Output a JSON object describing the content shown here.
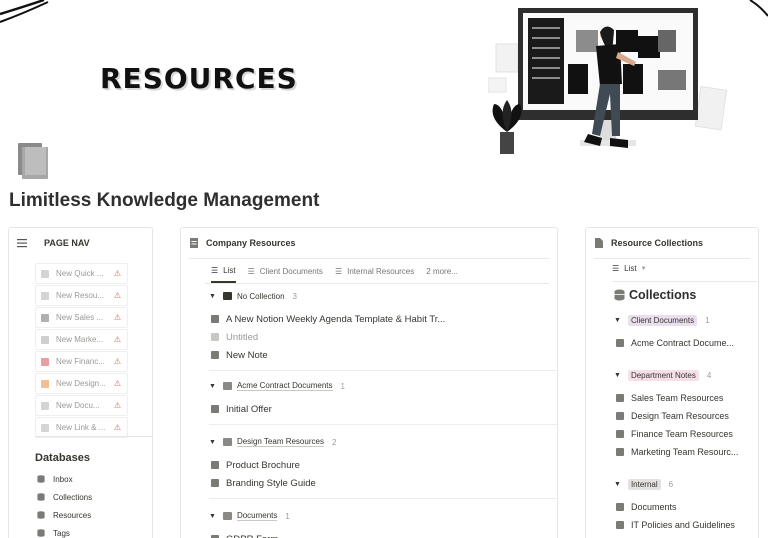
{
  "banner": {
    "title": "RESOURCES"
  },
  "page": {
    "title": "Limitless Knowledge Management"
  },
  "colors": {
    "warning": "#e06a5e",
    "client_tag_bg": "#e8deee",
    "dept_tag_bg": "#f5e0e9",
    "internal_tag_bg": "#e3e2e0"
  },
  "left_panel": {
    "header": "PAGE NAV",
    "nav_items": [
      {
        "label": "New Quick ...",
        "icon": "page-icon",
        "color": "#d4d4d2"
      },
      {
        "label": "New Resou...",
        "icon": "document-icon",
        "color": "#d4d4d2"
      },
      {
        "label": "New Sales ...",
        "icon": "chart-icon",
        "color": "#b0b0ae"
      },
      {
        "label": "New Marke...",
        "icon": "megaphone-icon",
        "color": "#cfcfcd"
      },
      {
        "label": "New Financ...",
        "icon": "finance-icon",
        "color": "#e8a0a0"
      },
      {
        "label": "New Design...",
        "icon": "palette-icon",
        "color": "#f0c090"
      },
      {
        "label": "New Docu...",
        "icon": "file-icon",
        "color": "#d4d4d2"
      },
      {
        "label": "New Link & ...",
        "icon": "link-icon",
        "color": "#d4d4d2"
      }
    ],
    "databases_title": "Databases",
    "databases": [
      "Inbox",
      "Collections",
      "Resources",
      "Tags"
    ]
  },
  "middle_panel": {
    "header": "Company Resources",
    "tabs": [
      "List",
      "Client Documents",
      "Internal Resources",
      "2 more..."
    ],
    "groups": [
      {
        "name": "No Collection",
        "count": "3",
        "items": [
          "A New Notion Weekly Agenda Template & Habit Tr...",
          "Untitled",
          "New Note"
        ]
      },
      {
        "name": "Acme Contract Documents",
        "count": "1",
        "items": [
          "Initial Offer"
        ]
      },
      {
        "name": "Design Team Resources",
        "count": "2",
        "items": [
          "Product Brochure",
          "Branding Style Guide"
        ]
      },
      {
        "name": "Documents",
        "count": "1",
        "items": [
          "GDPR Form"
        ]
      }
    ]
  },
  "right_panel": {
    "header": "Resource Collections",
    "view": "List",
    "collections_title": "Collections",
    "groups": [
      {
        "tag": "Client Documents",
        "count": "1",
        "items": [
          "Acme Contract Docume..."
        ]
      },
      {
        "tag": "Department Notes",
        "count": "4",
        "items": [
          "Sales Team Resources",
          "Design Team Resources",
          "Finance Team Resources",
          "Marketing Team Resourc..."
        ]
      },
      {
        "tag": "Internal",
        "count": "6",
        "items": [
          "Documents",
          "IT Policies and Guidelines"
        ]
      }
    ]
  }
}
